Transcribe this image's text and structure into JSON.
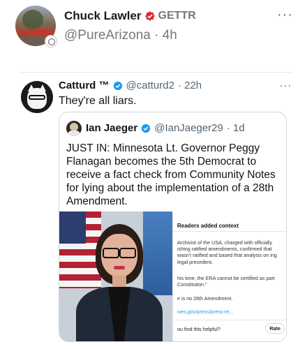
{
  "outer_post": {
    "author_name": "Chuck Lawler",
    "source_label": "GETTR",
    "handle": "@PureArizona",
    "time": "· 4h",
    "more_label": "···"
  },
  "tweet": {
    "author_name": "Catturd ™",
    "handle": "@catturd2",
    "time": "· 22h",
    "more_label": "···",
    "text": "They're all liars."
  },
  "quote": {
    "author_name": "Ian Jaeger",
    "handle": "@IanJaeger29",
    "time": "· 1d",
    "text": "JUST IN: Minnesota Lt. Governor Peggy Flanagan becomes the 5th Democrat to receive a fact check from Community Notes for lying about the implementation of a 28th Amendment."
  },
  "community_note": {
    "title": "Readers added context",
    "para1": "Archivist of the USA, charged with officially ishing ratified amendments, confirmed that wasn't ratified and based that analysis on ing legal precedent.",
    "para2": "his time, the ERA cannot be certified as part Constitution.\"",
    "para3": "e is no 28th Amendment.",
    "link": "ives.gov/press/press-re...",
    "question": "ou find this helpful?",
    "rate_label": "Rate"
  },
  "colors": {
    "gettr_red": "#e0252b",
    "verified_blue": "#1d9bf0",
    "text_secondary": "#536471"
  },
  "icons": [
    "gettr-verified-icon",
    "verified-badge-icon",
    "more-icon"
  ]
}
